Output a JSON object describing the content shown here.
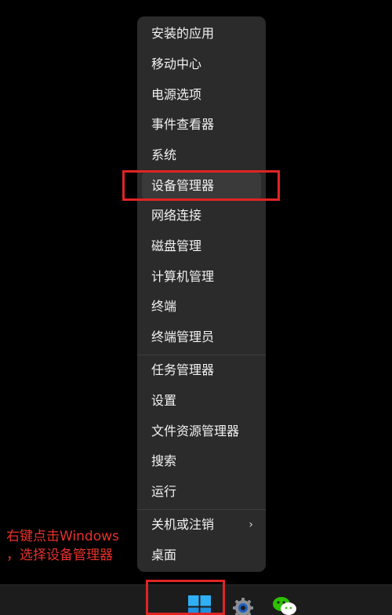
{
  "context_menu": {
    "items": [
      {
        "label": "安装的应用"
      },
      {
        "label": "移动中心"
      },
      {
        "label": "电源选项"
      },
      {
        "label": "事件查看器"
      },
      {
        "label": "系统"
      },
      {
        "label": "设备管理器"
      },
      {
        "label": "网络连接"
      },
      {
        "label": "磁盘管理"
      },
      {
        "label": "计算机管理"
      },
      {
        "label": "终端"
      },
      {
        "label": "终端管理员"
      },
      {
        "label": "任务管理器"
      },
      {
        "label": "设置"
      },
      {
        "label": "文件资源管理器"
      },
      {
        "label": "搜索"
      },
      {
        "label": "运行"
      },
      {
        "label": "关机或注销",
        "submenu_glyph": "›"
      },
      {
        "label": "桌面"
      }
    ],
    "highlighted_item": "设备管理器"
  },
  "annotation": {
    "line1": "右键点击Windows",
    "line2": "，选择设备管理器",
    "color": "#e8312a"
  },
  "taskbar": {
    "icons": [
      "windows-start-icon",
      "settings-gear-icon",
      "wechat-icon"
    ]
  },
  "colors": {
    "background": "#000000",
    "menu_bg": "#2b2b2b",
    "highlight_box": "#e02424",
    "start_icon": "#29a8f0"
  }
}
